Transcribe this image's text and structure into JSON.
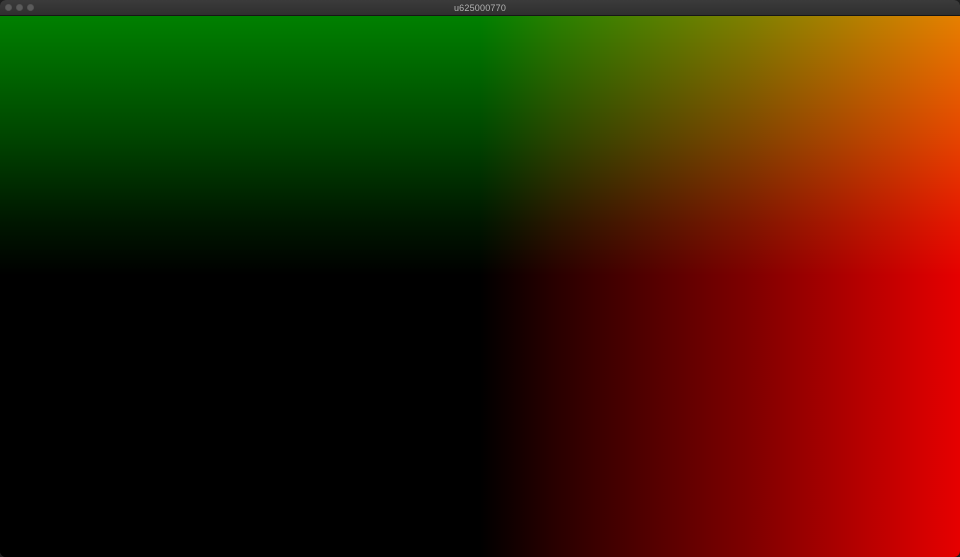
{
  "window": {
    "title": "u625000770",
    "controls": {
      "close": "close-icon",
      "minimize": "minimize-icon",
      "zoom": "zoom-icon"
    }
  },
  "canvas": {
    "description_colors": {
      "top": "#008000",
      "right": "#e60000",
      "bottom_left": "#000000"
    }
  }
}
